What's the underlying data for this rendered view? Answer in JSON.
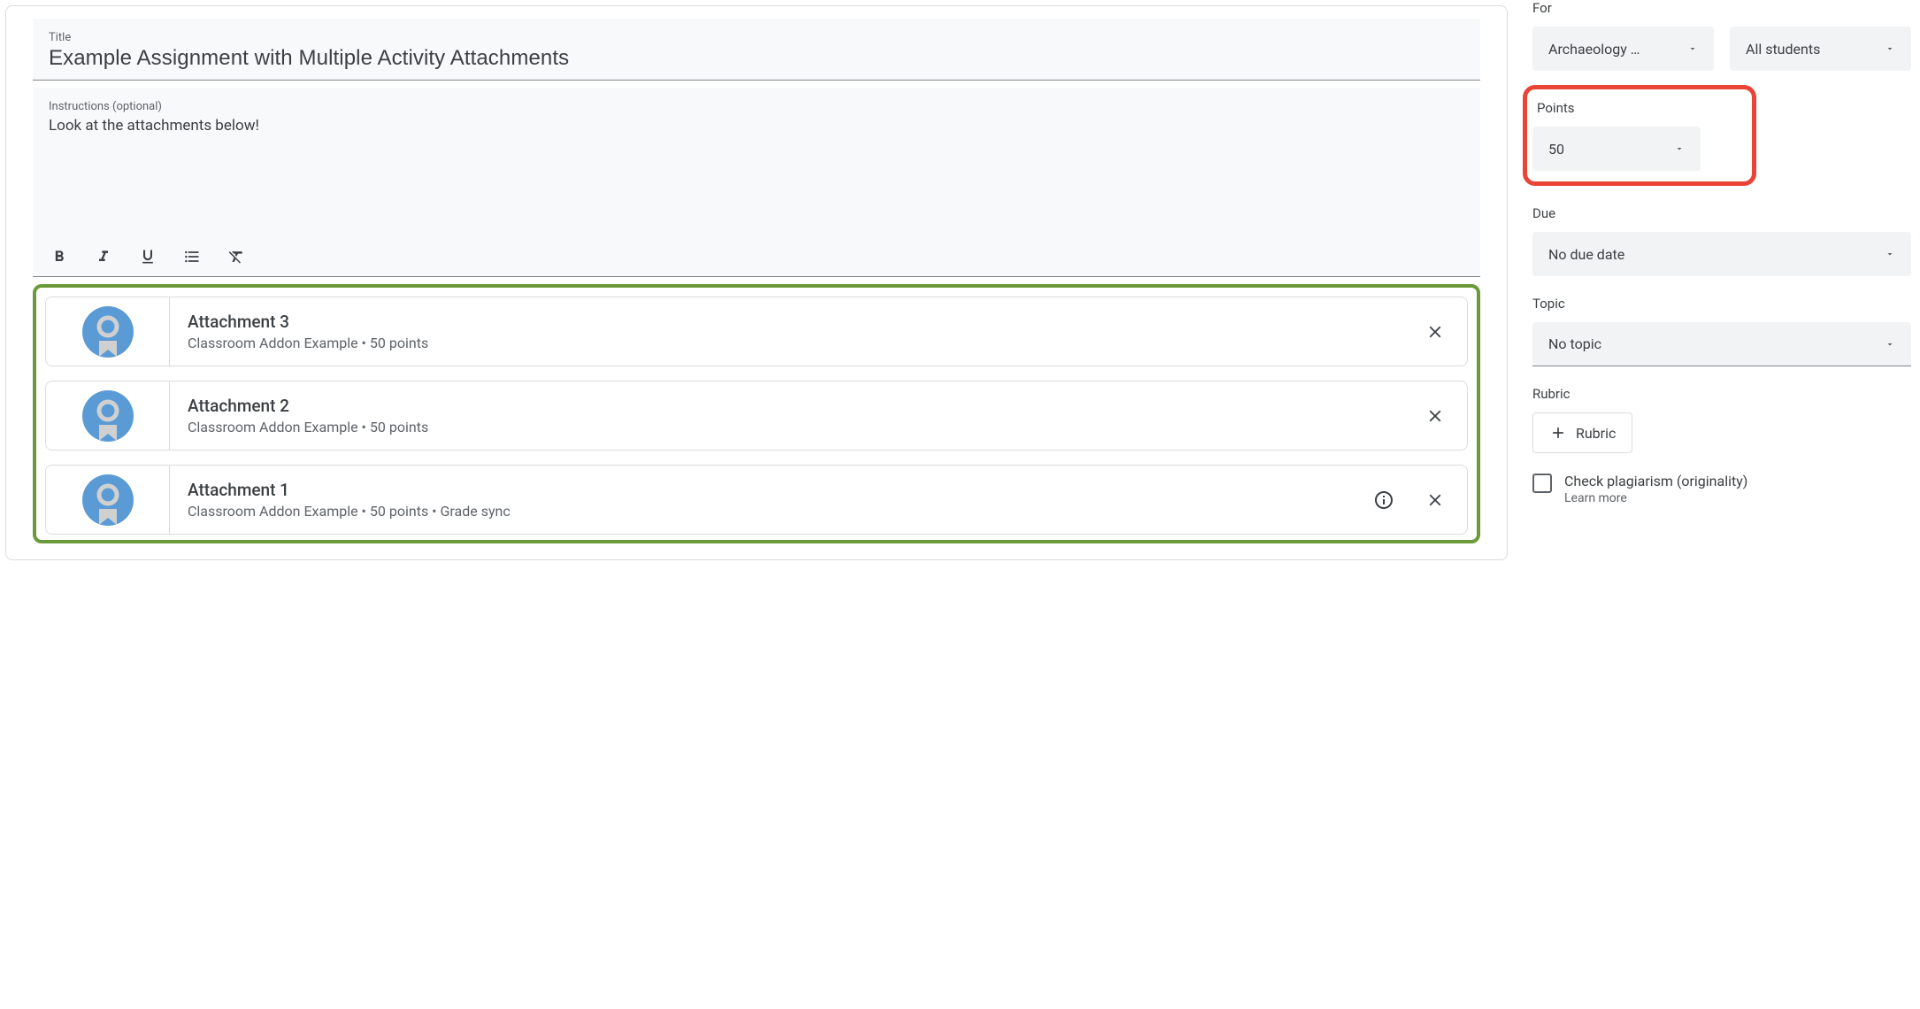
{
  "title": {
    "label": "Title",
    "value": "Example Assignment with Multiple Activity Attachments"
  },
  "instructions": {
    "label": "Instructions (optional)",
    "value": "Look at the attachments below!"
  },
  "attachments": [
    {
      "title": "Attachment 3",
      "meta": "Classroom Addon Example • 50 points",
      "has_info": false
    },
    {
      "title": "Attachment 2",
      "meta": "Classroom Addon Example • 50 points",
      "has_info": false
    },
    {
      "title": "Attachment 1",
      "meta": "Classroom Addon Example • 50 points • Grade sync",
      "has_info": true
    }
  ],
  "sidebar": {
    "for_label": "For",
    "class_value": "Archaeology …",
    "students_value": "All students",
    "points_label": "Points",
    "points_value": "50",
    "due_label": "Due",
    "due_value": "No due date",
    "topic_label": "Topic",
    "topic_value": "No topic",
    "rubric_label": "Rubric",
    "rubric_button": "Rubric",
    "plagiarism_label": "Check plagiarism (originality)",
    "learn_more": "Learn more"
  }
}
